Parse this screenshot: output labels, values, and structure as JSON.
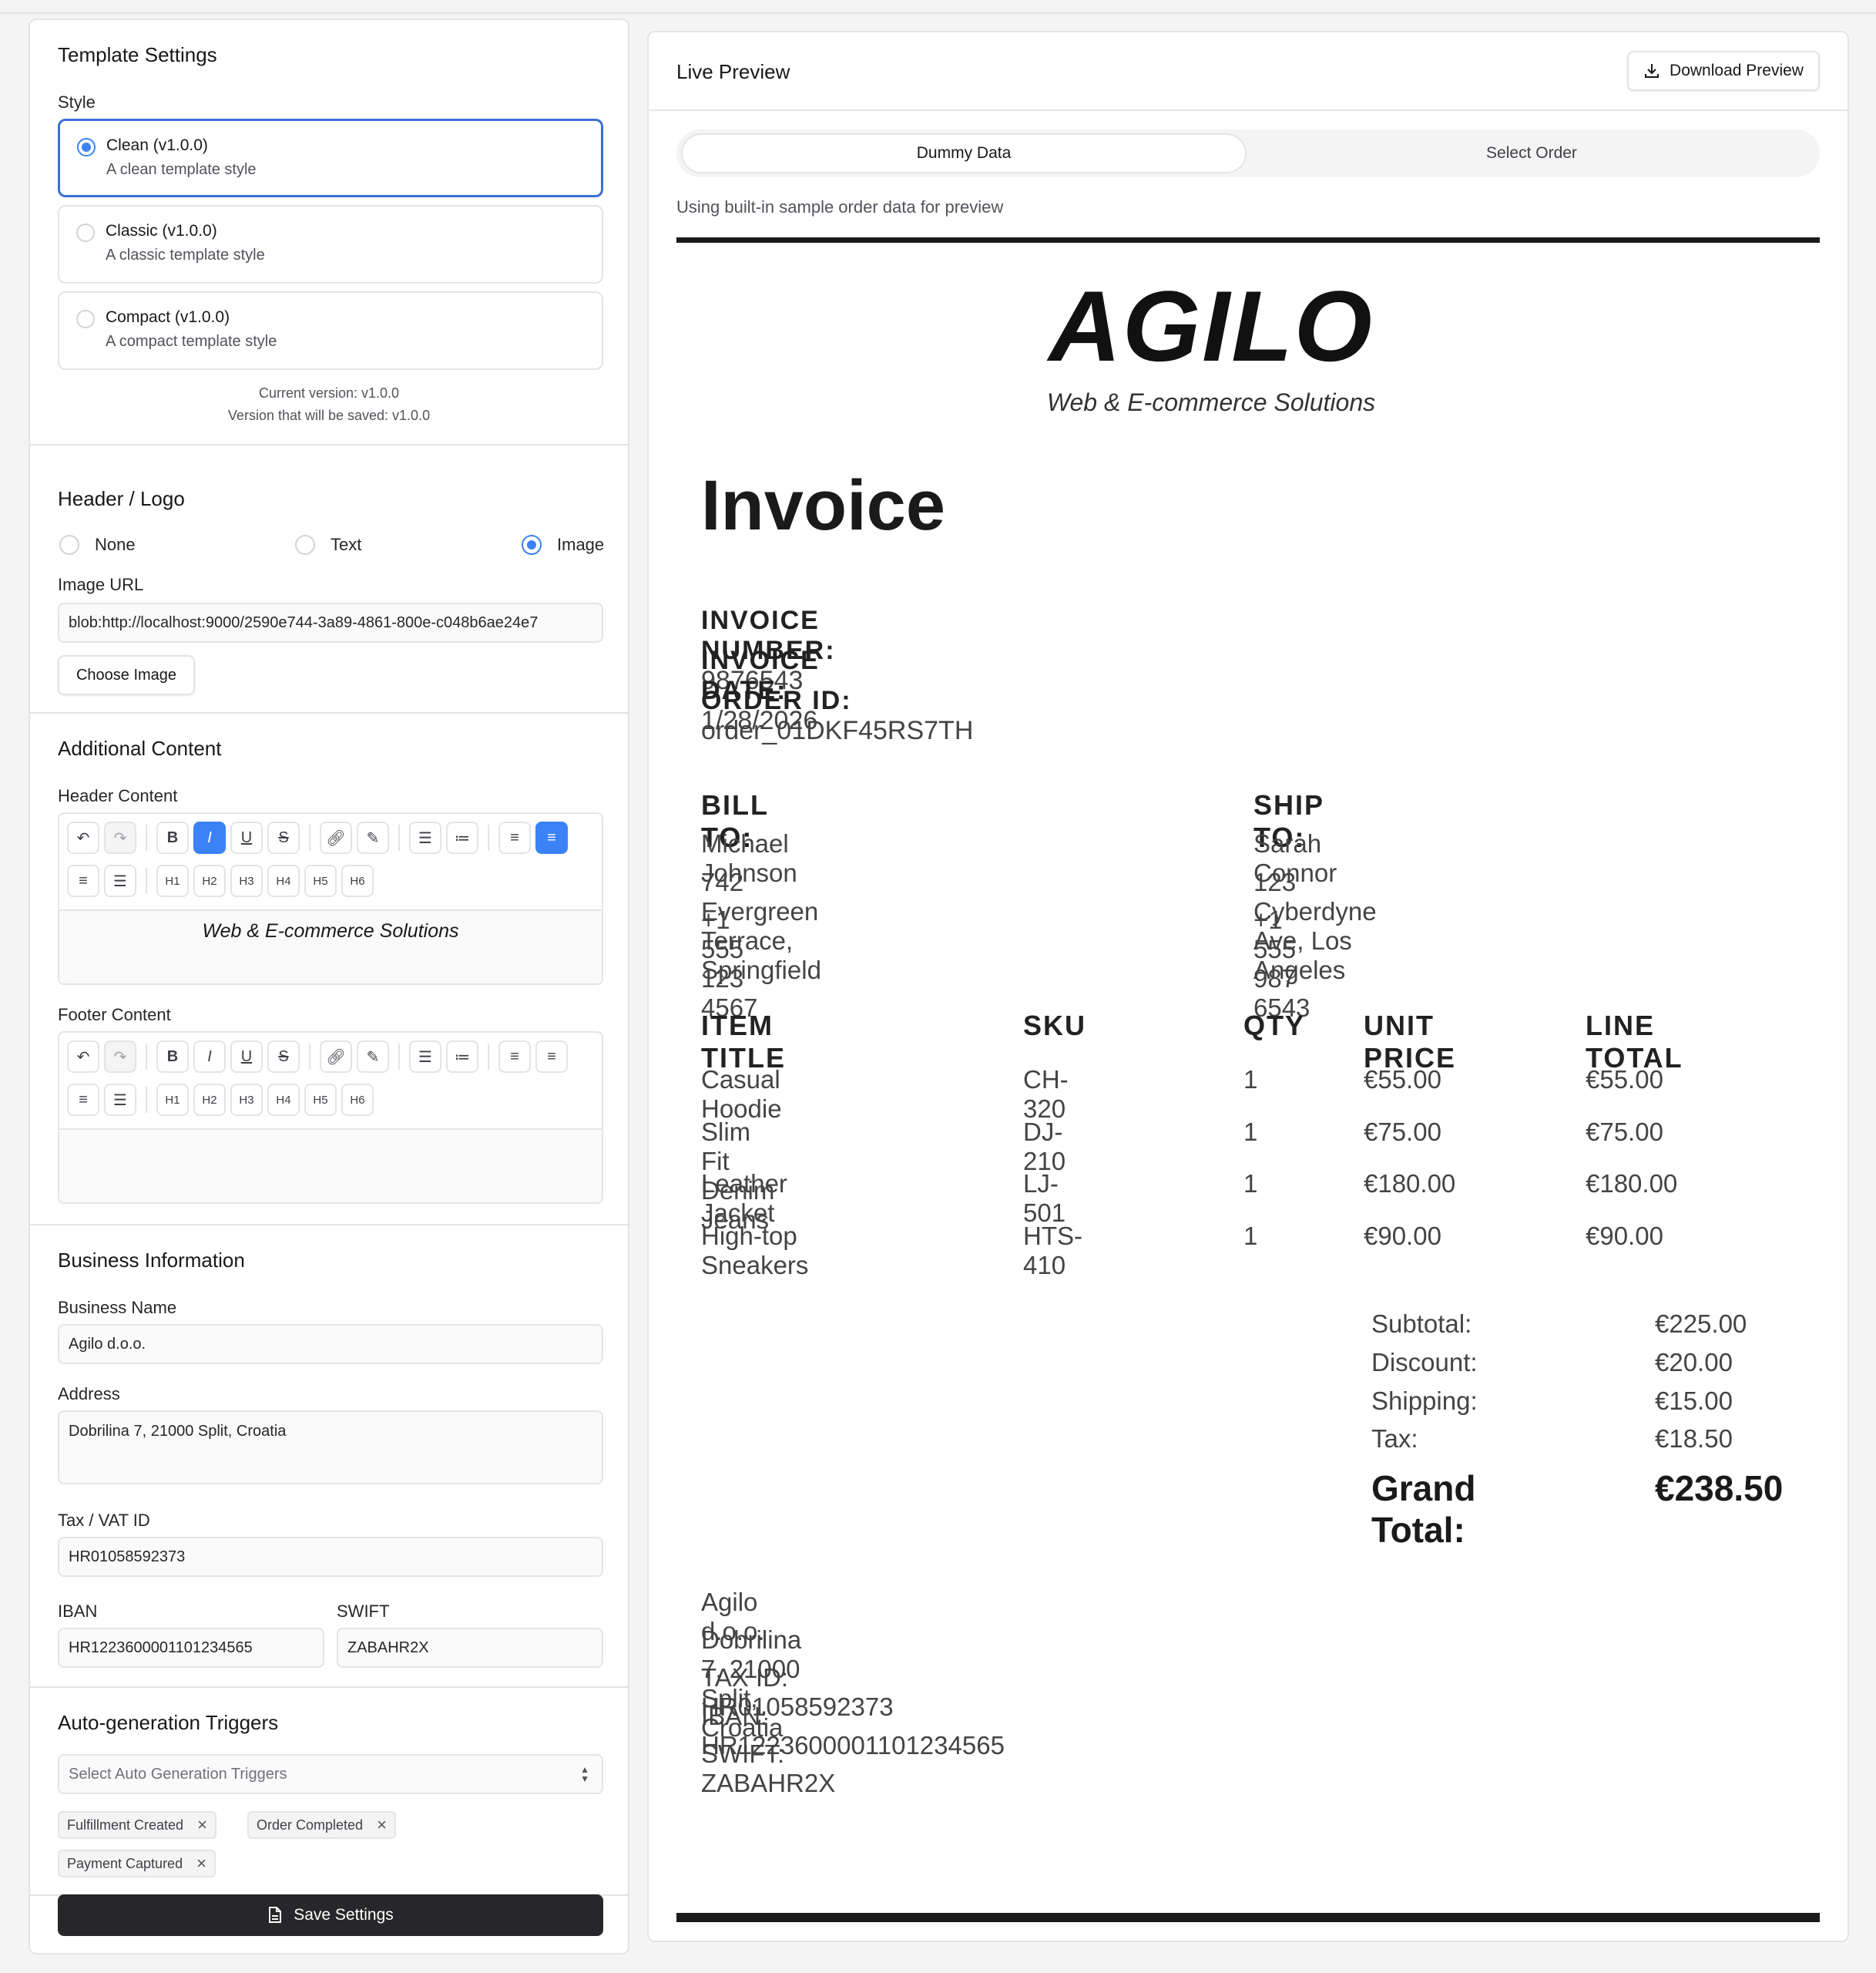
{
  "settings": {
    "template_title": "Template Settings",
    "style_label": "Style",
    "styles": [
      {
        "name": "Clean (v1.0.0)",
        "desc": "A clean template style",
        "selected": true
      },
      {
        "name": "Classic (v1.0.0)",
        "desc": "A classic template style",
        "selected": false
      },
      {
        "name": "Compact (v1.0.0)",
        "desc": "A compact template style",
        "selected": false
      }
    ],
    "current_version": "Current version: v1.0.0",
    "saved_version": "Version that will be saved: v1.0.0",
    "header_logo_title": "Header / Logo",
    "logo_options": [
      "None",
      "Text",
      "Image"
    ],
    "logo_selected": "Image",
    "image_url_label": "Image URL",
    "image_url_value": "blob:http://localhost:9000/2590e744-3a89-4861-800e-c048b6ae24e7",
    "choose_image": "Choose Image",
    "additional_title": "Additional Content",
    "header_content_label": "Header Content",
    "header_content_value": "Web & E-commerce Solutions",
    "footer_content_label": "Footer Content",
    "footer_content_value": "",
    "toolbar_headings": [
      "H1",
      "H2",
      "H3",
      "H4",
      "H5",
      "H6"
    ],
    "business_title": "Business Information",
    "business_name_label": "Business Name",
    "business_name_value": "Agilo d.o.o.",
    "address_label": "Address",
    "address_value": "Dobrilina 7, 21000 Split, Croatia",
    "tax_label": "Tax / VAT ID",
    "tax_value": "HR01058592373",
    "iban_label": "IBAN",
    "iban_value": "HR1223600001101234565",
    "swift_label": "SWIFT",
    "swift_value": "ZABAHR2X",
    "triggers_title": "Auto-generation Triggers",
    "triggers_placeholder": "Select Auto Generation Triggers",
    "triggers": [
      "Fulfillment Created",
      "Order Completed",
      "Payment Captured"
    ],
    "save_label": "Save Settings"
  },
  "preview": {
    "title": "Live Preview",
    "download_label": "Download Preview",
    "tab_dummy": "Dummy Data",
    "tab_select": "Select Order",
    "hint": "Using built-in sample order data for preview",
    "logo_text": "AGILO",
    "logo_sub": "Web & E-commerce Solutions",
    "invoice_heading": "Invoice",
    "invoice_number_label": "INVOICE NUMBER:",
    "invoice_number": "9876543",
    "invoice_date_label": "INVOICE DATE:",
    "invoice_date": "1/28/2026",
    "order_id_label": "ORDER ID:",
    "order_id": "order_01DKF45RS7TH",
    "bill_to_label": "BILL TO:",
    "bill_to": [
      "Michael Johnson",
      "742 Evergreen Terrace, Springfield",
      "+1 555 123 4567"
    ],
    "ship_to_label": "SHIP TO:",
    "ship_to": [
      "Sarah Connor",
      "123 Cyberdyne Ave, Los Angeles",
      "+1 555 987 6543"
    ],
    "columns": [
      "ITEM TITLE",
      "SKU",
      "QTY",
      "UNIT PRICE",
      "LINE TOTAL"
    ],
    "items": [
      [
        "Casual Hoodie",
        "CH-320",
        "1",
        "€55.00",
        "€55.00"
      ],
      [
        "Slim Fit Denim Jeans",
        "DJ-210",
        "1",
        "€75.00",
        "€75.00"
      ],
      [
        "Leather Jacket",
        "LJ-501",
        "1",
        "€180.00",
        "€180.00"
      ],
      [
        "High-top Sneakers",
        "HTS-410",
        "1",
        "€90.00",
        "€90.00"
      ]
    ],
    "totals": [
      [
        "Subtotal:",
        "€225.00"
      ],
      [
        "Discount:",
        "€20.00"
      ],
      [
        "Shipping:",
        "€15.00"
      ],
      [
        "Tax:",
        "€18.50"
      ]
    ],
    "grand_total_label": "Grand Total:",
    "grand_total": "€238.50",
    "footer": [
      "Agilo d.o.o.",
      "Dobrilina 7, 21000 Split, Croatia",
      "TAX ID:  HR01058592373",
      "IBAN:  HR1223600001101234565",
      "SWIFT:  ZABAHR2X"
    ]
  }
}
